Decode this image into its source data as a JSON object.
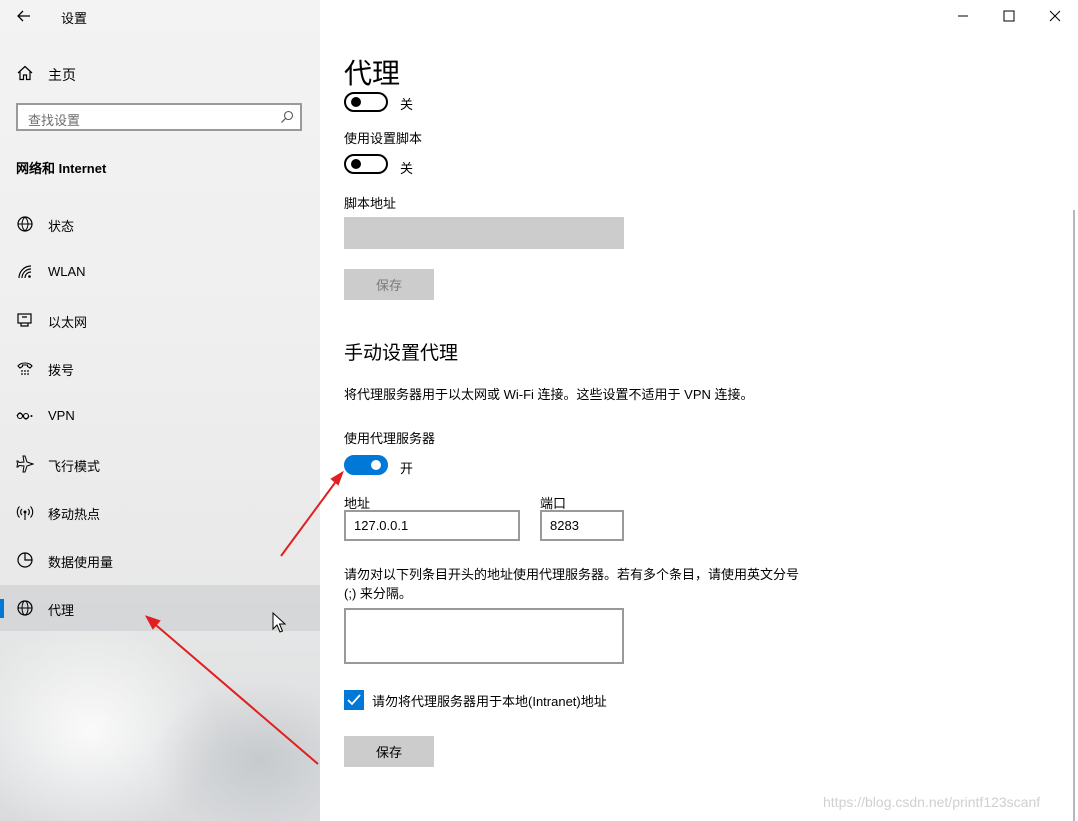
{
  "window": {
    "title": "设置"
  },
  "sidebar": {
    "home_label": "主页",
    "search_placeholder": "查找设置",
    "section_title": "网络和 Internet",
    "items": [
      {
        "label": "状态",
        "icon": "status-icon"
      },
      {
        "label": "WLAN",
        "icon": "wifi-icon"
      },
      {
        "label": "以太网",
        "icon": "ethernet-icon"
      },
      {
        "label": "拨号",
        "icon": "dialup-icon"
      },
      {
        "label": "VPN",
        "icon": "vpn-icon"
      },
      {
        "label": "飞行模式",
        "icon": "airplane-icon"
      },
      {
        "label": "移动热点",
        "icon": "hotspot-icon"
      },
      {
        "label": "数据使用量",
        "icon": "data-usage-icon"
      },
      {
        "label": "代理",
        "icon": "globe-icon",
        "active": true
      }
    ]
  },
  "main": {
    "page_title": "代理",
    "auto_detect_toggle_state": "关",
    "use_script_label": "使用设置脚本",
    "use_script_toggle_state": "关",
    "script_address_label": "脚本地址",
    "script_save_label": "保存",
    "manual_title": "手动设置代理",
    "manual_desc": "将代理服务器用于以太网或 Wi-Fi 连接。这些设置不适用于 VPN 连接。",
    "use_proxy_label": "使用代理服务器",
    "use_proxy_toggle_state": "开",
    "address_label": "地址",
    "address_value": "127.0.0.1",
    "port_label": "端口",
    "port_value": "8283",
    "exceptions_text": "请勿对以下列条目开头的地址使用代理服务器。若有多个条目，请使用英文分号 (;) 来分隔。",
    "bypass_local_label": "请勿将代理服务器用于本地(Intranet)地址",
    "bypass_local_checked": true,
    "save_label": "保存"
  },
  "watermark": "https://blog.csdn.net/printf123scanf",
  "colors": {
    "accent": "#0078d7",
    "annotation_arrow": "#e02020"
  }
}
